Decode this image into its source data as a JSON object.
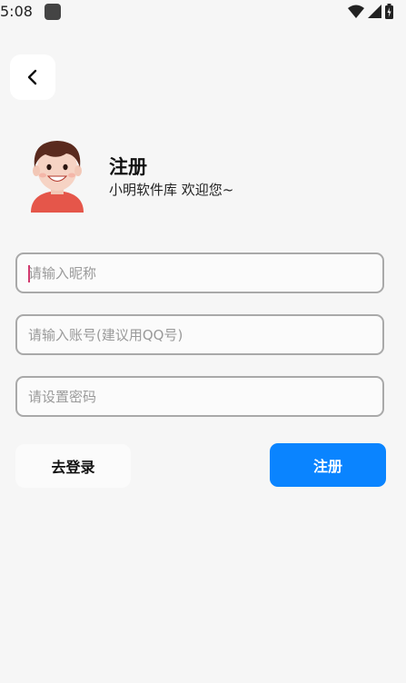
{
  "status_bar": {
    "time": "5:08"
  },
  "header": {
    "title": "注册",
    "subtitle": "小明软件库 欢迎您~"
  },
  "form": {
    "nickname_placeholder": "请输入昵称",
    "account_placeholder": "请输入账号(建议用QQ号)",
    "password_placeholder": "请设置密码"
  },
  "actions": {
    "login_label": "去登录",
    "register_label": "注册"
  },
  "colors": {
    "accent": "#0a84ff",
    "background": "#f6f6f6",
    "input_border": "#a9a9a9"
  }
}
